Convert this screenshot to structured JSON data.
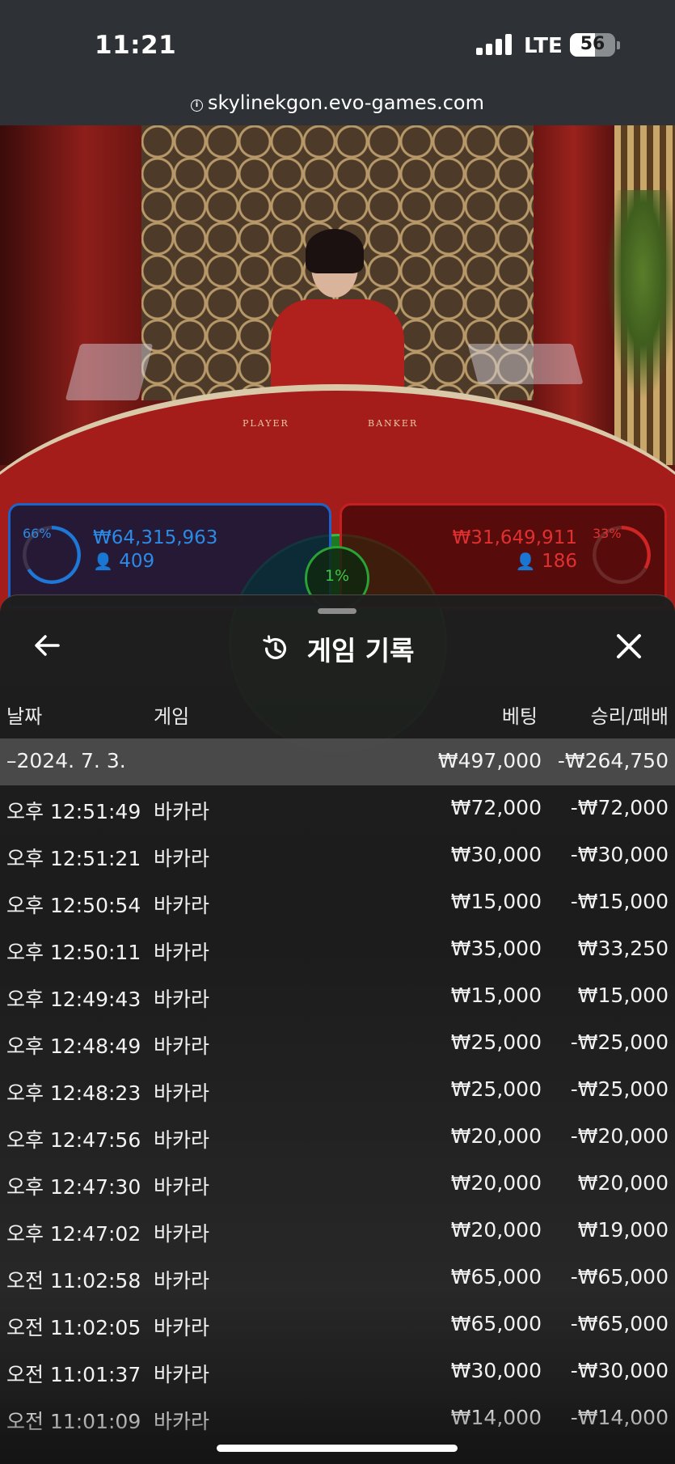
{
  "status_bar": {
    "time": "11:21",
    "network": "LTE",
    "battery_level": "56",
    "battery_fraction": 0.56
  },
  "browser": {
    "url": "skylinekgon.evo-games.com"
  },
  "video": {
    "table_labels": {
      "player": "PLAYER",
      "banker": "BANKER"
    }
  },
  "bets": {
    "player": {
      "percent": "66%",
      "fraction": 0.66,
      "amount": "₩64,315,963",
      "players": "409",
      "color": "#1e78d8"
    },
    "tie": {
      "percent": "1%",
      "fraction": 0.01,
      "color": "#3fc54a"
    },
    "banker": {
      "percent": "33%",
      "fraction": 0.33,
      "amount": "₩31,649,911",
      "players": "186",
      "color": "#d02525"
    }
  },
  "history": {
    "title": "게임 기록",
    "back_icon": "arrow-left-icon",
    "title_icon": "history-icon",
    "close_icon": "close-icon",
    "columns": {
      "date": "날짜",
      "game": "게임",
      "bet": "베팅",
      "result": "승리/패배"
    },
    "day_summary": {
      "date": "–2024. 7. 3.",
      "bet": "₩497,000",
      "result": "-₩264,750"
    },
    "rows": [
      {
        "time": "오후 12:51:49",
        "game": "바카라",
        "bet": "₩72,000",
        "result": "-₩72,000"
      },
      {
        "time": "오후 12:51:21",
        "game": "바카라",
        "bet": "₩30,000",
        "result": "-₩30,000"
      },
      {
        "time": "오후 12:50:54",
        "game": "바카라",
        "bet": "₩15,000",
        "result": "-₩15,000"
      },
      {
        "time": "오후 12:50:11",
        "game": "바카라",
        "bet": "₩35,000",
        "result": "₩33,250"
      },
      {
        "time": "오후 12:49:43",
        "game": "바카라",
        "bet": "₩15,000",
        "result": "₩15,000"
      },
      {
        "time": "오후 12:48:49",
        "game": "바카라",
        "bet": "₩25,000",
        "result": "-₩25,000"
      },
      {
        "time": "오후 12:48:23",
        "game": "바카라",
        "bet": "₩25,000",
        "result": "-₩25,000"
      },
      {
        "time": "오후 12:47:56",
        "game": "바카라",
        "bet": "₩20,000",
        "result": "-₩20,000"
      },
      {
        "time": "오후 12:47:30",
        "game": "바카라",
        "bet": "₩20,000",
        "result": "₩20,000"
      },
      {
        "time": "오후 12:47:02",
        "game": "바카라",
        "bet": "₩20,000",
        "result": "₩19,000"
      },
      {
        "time": "오전 11:02:58",
        "game": "바카라",
        "bet": "₩65,000",
        "result": "-₩65,000"
      },
      {
        "time": "오전 11:02:05",
        "game": "바카라",
        "bet": "₩65,000",
        "result": "-₩65,000"
      },
      {
        "time": "오전 11:01:37",
        "game": "바카라",
        "bet": "₩30,000",
        "result": "-₩30,000"
      },
      {
        "time": "오전 11:01:09",
        "game": "바카라",
        "bet": "₩14,000",
        "result": "-₩14,000"
      }
    ]
  }
}
